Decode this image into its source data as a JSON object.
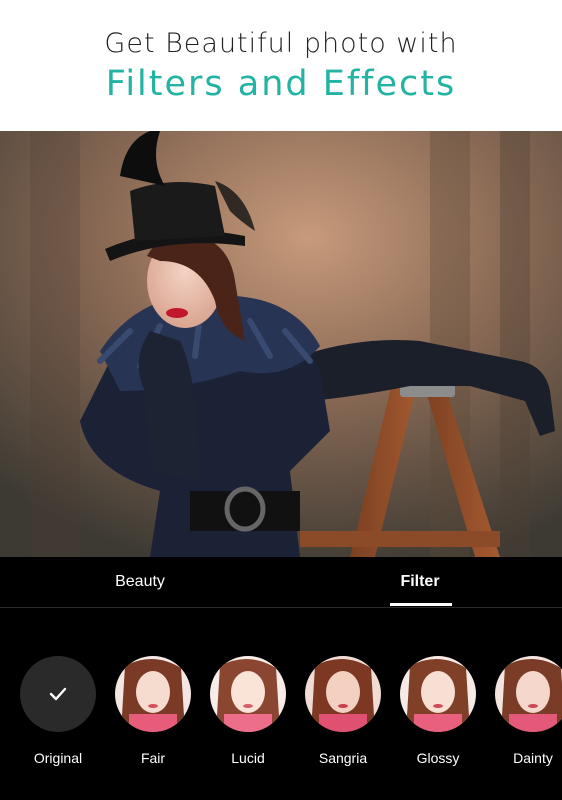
{
  "header": {
    "line1": "Get Beautiful photo with",
    "line2": "Filters and Effects",
    "accent_color": "#22b3a3"
  },
  "tabs": [
    {
      "label": "Beauty",
      "active": false
    },
    {
      "label": "Filter",
      "active": true
    }
  ],
  "filters": [
    {
      "label": "Original",
      "icon": "check-icon",
      "selected": true
    },
    {
      "label": "Fair"
    },
    {
      "label": "Lucid"
    },
    {
      "label": "Sangria"
    },
    {
      "label": "Glossy"
    },
    {
      "label": "Dainty"
    }
  ]
}
